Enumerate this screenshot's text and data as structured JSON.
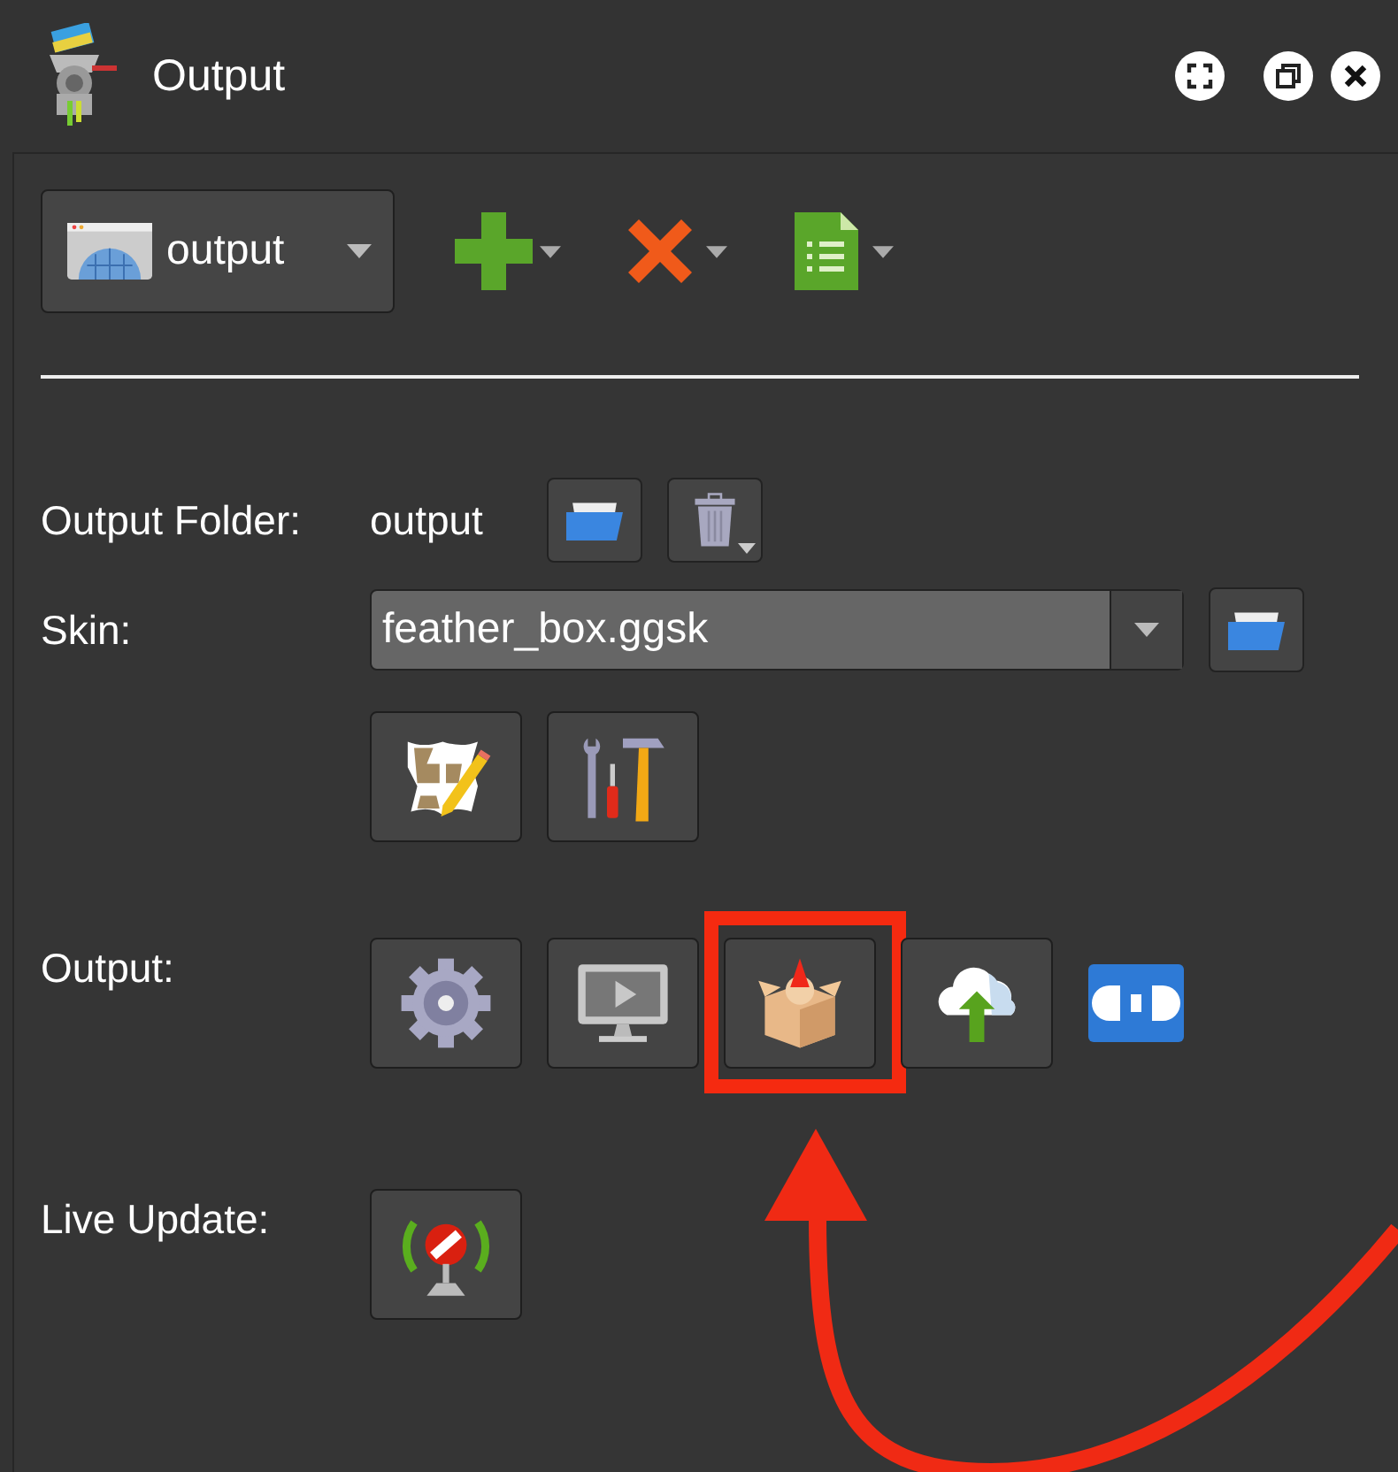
{
  "window": {
    "title": "Output"
  },
  "toolbar": {
    "preset": "output"
  },
  "output_folder": {
    "label": "Output Folder:",
    "value": "output"
  },
  "skin": {
    "label": "Skin:",
    "value": "feather_box.ggsk"
  },
  "output": {
    "label": "Output:",
    "buttons": [
      {
        "kind": "settings",
        "highlighted": false
      },
      {
        "kind": "preview",
        "highlighted": false
      },
      {
        "kind": "package",
        "highlighted": true
      },
      {
        "kind": "upload",
        "highlighted": false
      },
      {
        "kind": "plugin",
        "highlighted": false
      }
    ]
  },
  "live_update": {
    "label": "Live Update:"
  }
}
